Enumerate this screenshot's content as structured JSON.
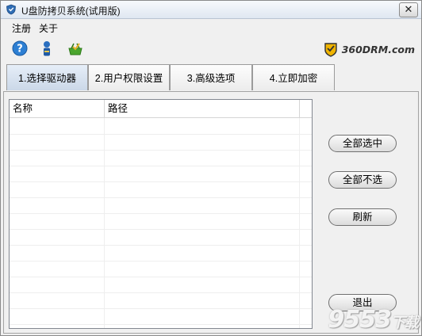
{
  "window": {
    "title": "U盘防拷贝系统(试用版)",
    "close_label": "✕"
  },
  "menu": {
    "items": [
      {
        "label": "注册"
      },
      {
        "label": "关于"
      }
    ]
  },
  "brand": {
    "text": "360DRM.com"
  },
  "tabs": [
    {
      "label": "1.选择驱动器",
      "active": true
    },
    {
      "label": "2.用户权限设置",
      "active": false
    },
    {
      "label": "3.高级选项",
      "active": false
    },
    {
      "label": "4.立即加密",
      "active": false
    }
  ],
  "list": {
    "columns": [
      "名称",
      "路径"
    ],
    "rows": []
  },
  "buttons": {
    "select_all": "全部选中",
    "select_none": "全部不选",
    "refresh": "刷新",
    "exit": "退出"
  },
  "watermark": {
    "main": "9553",
    "suffix": "下载"
  }
}
